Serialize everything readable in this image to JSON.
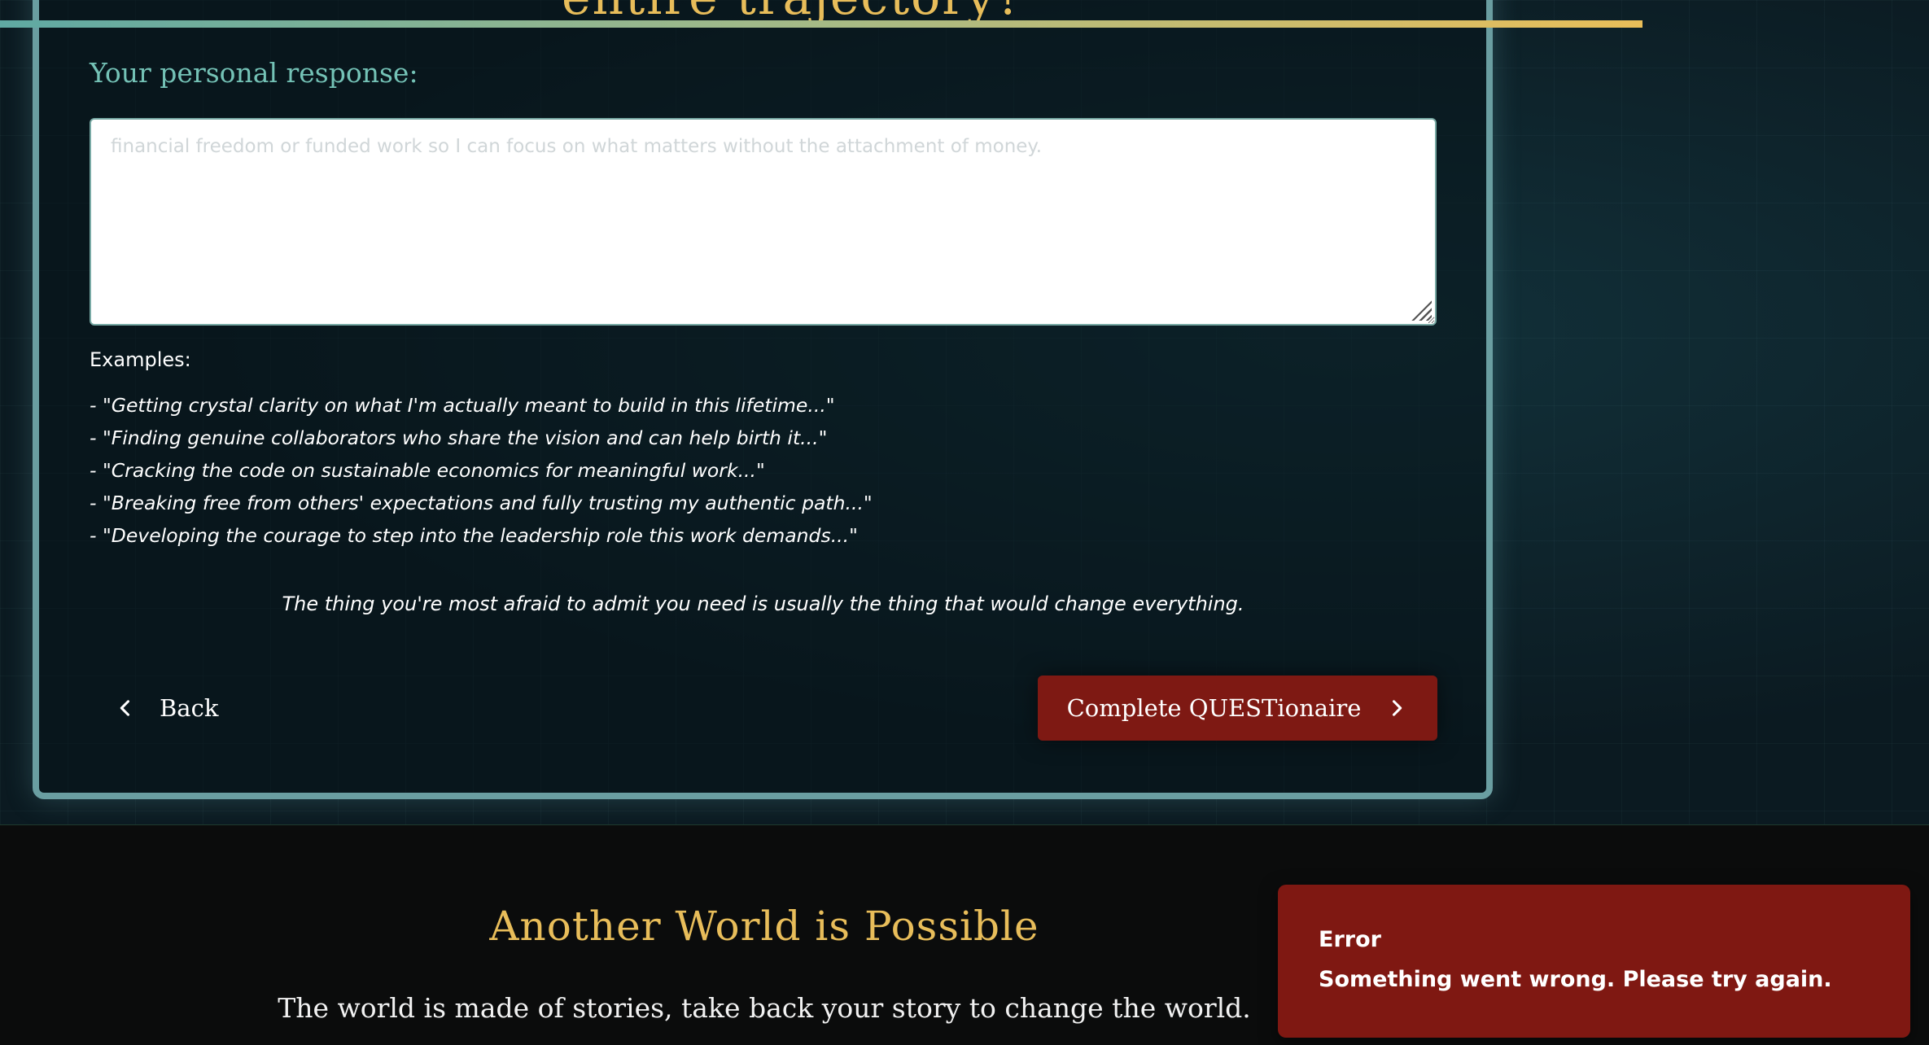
{
  "question": {
    "title_fragment": "entire trajectory?",
    "response_label": "Your personal response:",
    "response_value": "",
    "response_placeholder": "financial freedom or funded work so I can focus on what matters without the attachment of money."
  },
  "examples": {
    "title": "Examples:",
    "items": [
      "- \"Getting crystal clarity on what I'm actually meant to build in this lifetime...\"",
      "- \"Finding genuine collaborators who share the vision and can help birth it...\"",
      "- \"Cracking the code on sustainable economics for meaningful work...\"",
      "- \"Breaking free from others' expectations and fully trusting my authentic path...\"",
      "- \"Developing the courage to step into the leadership role this work demands...\""
    ]
  },
  "quote": "The thing you're most afraid to admit you need is usually the thing that would change everything.",
  "navigation": {
    "back_label": "Back",
    "complete_label": "Complete QUESTionaire",
    "back_icon": "chevron-left-icon",
    "complete_icon": "chevron-right-icon"
  },
  "footer": {
    "title": "Another World is Possible",
    "subtitle": "The world is made of stories, take back your story to change the world."
  },
  "toast": {
    "title": "Error",
    "message": "Something went wrong. Please try again."
  },
  "colors": {
    "accent_teal": "#74c2b6",
    "accent_gold": "#e8bd5a",
    "button_red": "#7e1913",
    "error_red": "#7f1812"
  }
}
